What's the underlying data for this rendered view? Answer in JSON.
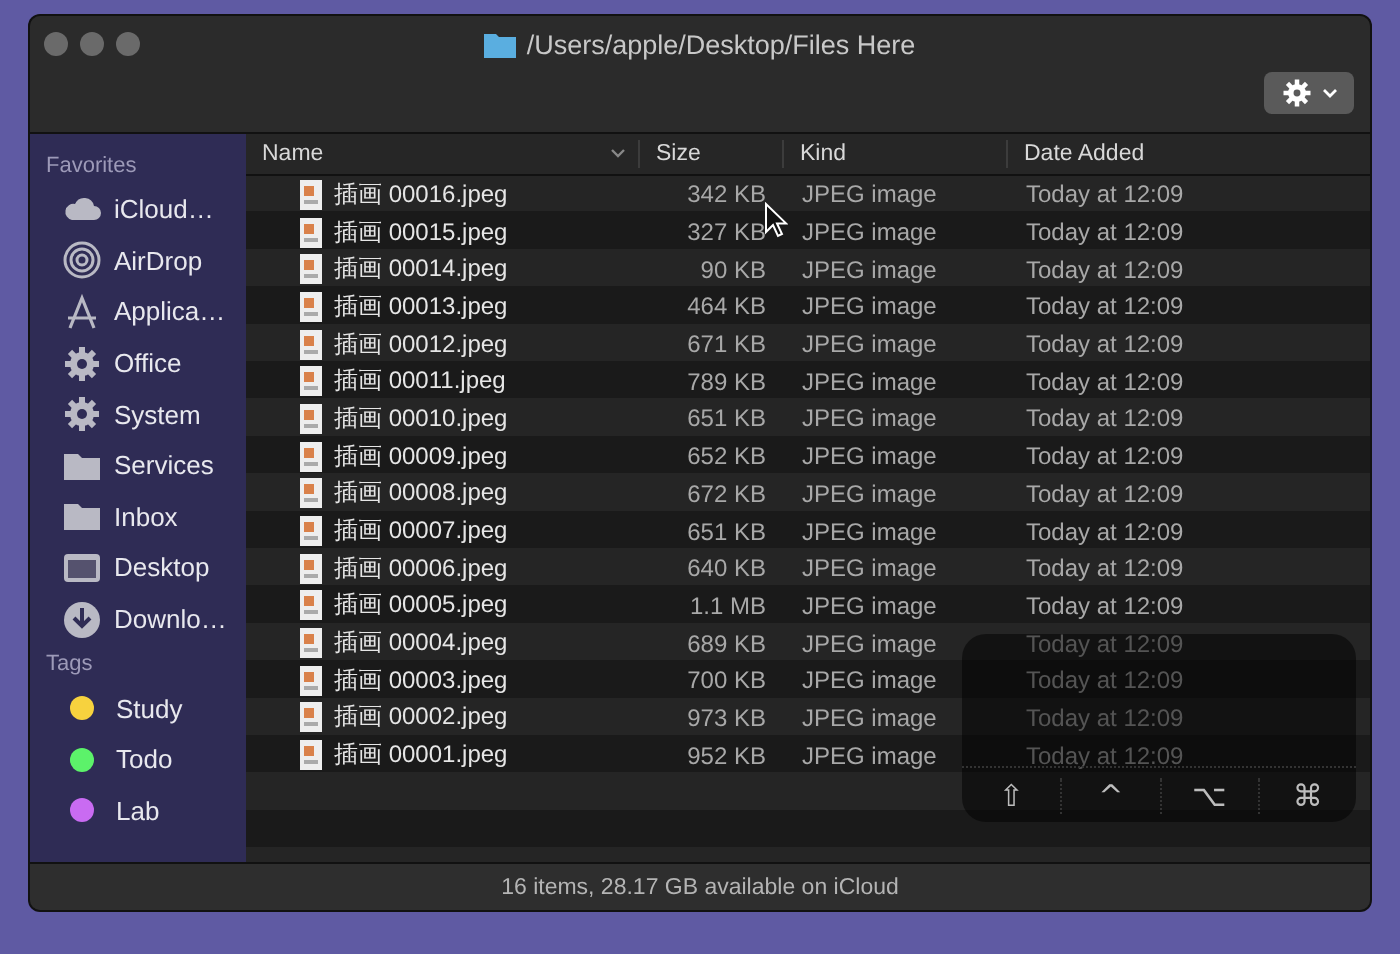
{
  "window": {
    "title": "/Users/apple/Desktop/Files Here"
  },
  "sidebar": {
    "sections": [
      {
        "heading": "Favorites",
        "items": [
          {
            "label": "iCloud…",
            "kind": "cloud"
          },
          {
            "label": "AirDrop",
            "kind": "airdrop"
          },
          {
            "label": "Applica…",
            "kind": "apps"
          },
          {
            "label": "Office",
            "kind": "gear"
          },
          {
            "label": "System",
            "kind": "gear"
          },
          {
            "label": "Services",
            "kind": "folder"
          },
          {
            "label": "Inbox",
            "kind": "folder"
          },
          {
            "label": "Desktop",
            "kind": "desktop"
          },
          {
            "label": "Downlo…",
            "kind": "download"
          }
        ]
      },
      {
        "heading": "Tags",
        "items": [
          {
            "label": "Study",
            "kind": "tag",
            "color": "#f7d23e"
          },
          {
            "label": "Todo",
            "kind": "tag",
            "color": "#5cf26a"
          },
          {
            "label": "Lab",
            "kind": "tag",
            "color": "#c96bf2"
          }
        ]
      }
    ]
  },
  "table": {
    "columns": [
      "Name",
      "Size",
      "Kind",
      "Date Added"
    ],
    "rows": [
      {
        "name": "插画 00016.jpeg",
        "size": "342 KB",
        "kind": "JPEG image",
        "date": "Today at 12:09"
      },
      {
        "name": "插画 00015.jpeg",
        "size": "327 KB",
        "kind": "JPEG image",
        "date": "Today at 12:09"
      },
      {
        "name": "插画 00014.jpeg",
        "size": "90 KB",
        "kind": "JPEG image",
        "date": "Today at 12:09"
      },
      {
        "name": "插画 00013.jpeg",
        "size": "464 KB",
        "kind": "JPEG image",
        "date": "Today at 12:09"
      },
      {
        "name": "插画 00012.jpeg",
        "size": "671 KB",
        "kind": "JPEG image",
        "date": "Today at 12:09"
      },
      {
        "name": "插画 00011.jpeg",
        "size": "789 KB",
        "kind": "JPEG image",
        "date": "Today at 12:09"
      },
      {
        "name": "插画 00010.jpeg",
        "size": "651 KB",
        "kind": "JPEG image",
        "date": "Today at 12:09"
      },
      {
        "name": "插画 00009.jpeg",
        "size": "652 KB",
        "kind": "JPEG image",
        "date": "Today at 12:09"
      },
      {
        "name": "插画 00008.jpeg",
        "size": "672 KB",
        "kind": "JPEG image",
        "date": "Today at 12:09"
      },
      {
        "name": "插画 00007.jpeg",
        "size": "651 KB",
        "kind": "JPEG image",
        "date": "Today at 12:09"
      },
      {
        "name": "插画 00006.jpeg",
        "size": "640 KB",
        "kind": "JPEG image",
        "date": "Today at 12:09"
      },
      {
        "name": "插画 00005.jpeg",
        "size": "1.1 MB",
        "kind": "JPEG image",
        "date": "Today at 12:09"
      },
      {
        "name": "插画 00004.jpeg",
        "size": "689 KB",
        "kind": "JPEG image",
        "date": "Today at 12:09"
      },
      {
        "name": "插画 00003.jpeg",
        "size": "700 KB",
        "kind": "JPEG image",
        "date": "Today at 12:09"
      },
      {
        "name": "插画 00002.jpeg",
        "size": "973 KB",
        "kind": "JPEG image",
        "date": "Today at 12:09"
      },
      {
        "name": "插画 00001.jpeg",
        "size": "952 KB",
        "kind": "JPEG image",
        "date": "Today at 12:09"
      }
    ]
  },
  "status_bar": "16 items, 28.17 GB available on iCloud",
  "keystroke_overlay": {
    "keys": [
      "⇧",
      "^",
      "⌥",
      "⌘"
    ]
  }
}
